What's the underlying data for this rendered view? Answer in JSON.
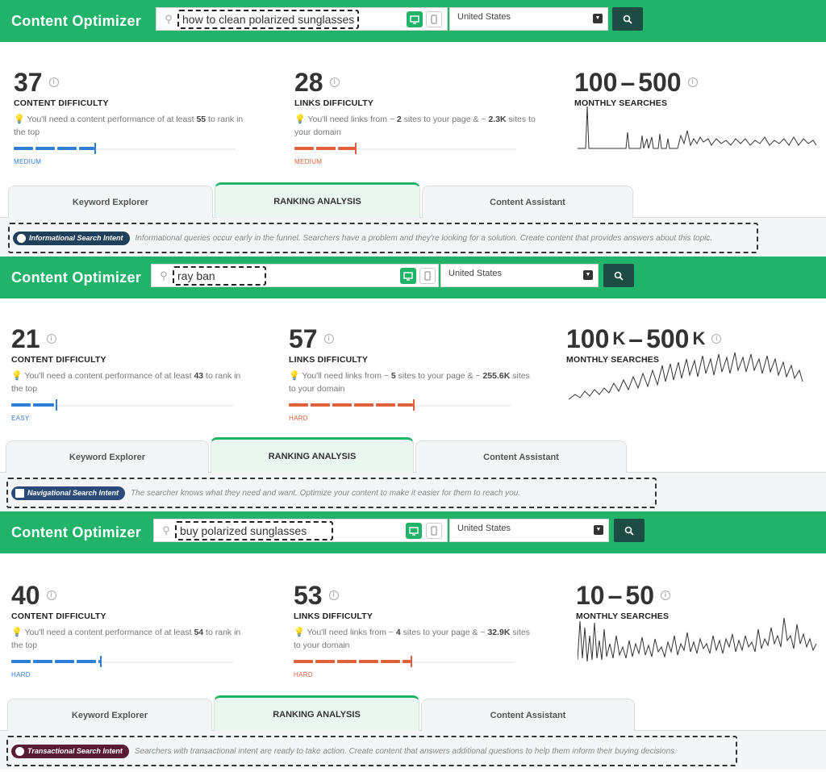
{
  "app": {
    "brand": "Content Optimizer"
  },
  "colors": {
    "green": "#22b36b",
    "blue": "#2f7ed8",
    "orange": "#e0603a",
    "navy": "#1d4c45"
  },
  "panels": [
    {
      "keyword": "how to clean polarized sunglasses",
      "country": "United States",
      "content": {
        "value": "37",
        "label": "CONTENT DIFFICULTY",
        "hint_pre": "You'll need a content performance of at least ",
        "hint_num": "55",
        "hint_post": " to rank in the top",
        "level": "MEDIUM"
      },
      "links": {
        "value": "28",
        "label": "LINKS DIFFICULTY",
        "hint_pre": "You'll need links from ~ ",
        "hint_num": "2",
        "hint_mid": " sites to your page & ~ ",
        "hint_num2": "2.3K",
        "hint_post": " sites to your domain",
        "level": "MEDIUM"
      },
      "searches": {
        "value_a": "100",
        "dash": "–",
        "value_b": "500",
        "unit": "",
        "label": "MONTHLY SEARCHES"
      },
      "tabs": [
        "Keyword Explorer",
        "RANKING ANALYSIS",
        "Content Assistant"
      ],
      "intent": {
        "badge": "Informational Search Intent",
        "text": "Informational queries occur early in the funnel. Searchers have a problem and they're looking for a solution. Create content that provides answers about this topic."
      }
    },
    {
      "keyword": "ray ban",
      "country": "United States",
      "content": {
        "value": "21",
        "label": "CONTENT DIFFICULTY",
        "hint_pre": "You'll need a content performance of at least ",
        "hint_num": "43",
        "hint_post": " to rank in the top",
        "level": "EASY"
      },
      "links": {
        "value": "57",
        "label": "LINKS DIFFICULTY",
        "hint_pre": "You'll need links from ~ ",
        "hint_num": "5",
        "hint_mid": " sites to your page & ~ ",
        "hint_num2": "255.6K",
        "hint_post": " sites to your domain",
        "level": "HARD"
      },
      "searches": {
        "value_a": "100",
        "dash": "–",
        "value_b": "500",
        "unit": "K",
        "label": "MONTHLY SEARCHES"
      },
      "tabs": [
        "Keyword Explorer",
        "RANKING ANALYSIS",
        "Content Assistant"
      ],
      "intent": {
        "badge": "Navigational Search Intent",
        "text": "The searcher knows what they need and want. Optimize your content to make it easier for them to reach you."
      }
    },
    {
      "keyword": "buy polarized sunglasses",
      "country": "United States",
      "content": {
        "value": "40",
        "label": "CONTENT DIFFICULTY",
        "hint_pre": "You'll need a content performance of at least ",
        "hint_num": "54",
        "hint_post": " to rank in the top",
        "level": "HARD"
      },
      "links": {
        "value": "53",
        "label": "LINKS DIFFICULTY",
        "hint_pre": "You'll need links from ~ ",
        "hint_num": "4",
        "hint_mid": " sites to your page & ~ ",
        "hint_num2": "32.9K",
        "hint_post": " sites to your domain",
        "level": "HARD"
      },
      "searches": {
        "value_a": "10",
        "dash": "–",
        "value_b": "50",
        "unit": "",
        "label": "MONTHLY SEARCHES"
      },
      "tabs": [
        "Keyword Explorer",
        "RANKING ANALYSIS",
        "Content Assistant"
      ],
      "intent": {
        "badge": "Transactional Search Intent",
        "text": "Searchers with transactional intent are ready to take action. Create content that answers additional questions to help them inform their buying decisions."
      }
    }
  ]
}
